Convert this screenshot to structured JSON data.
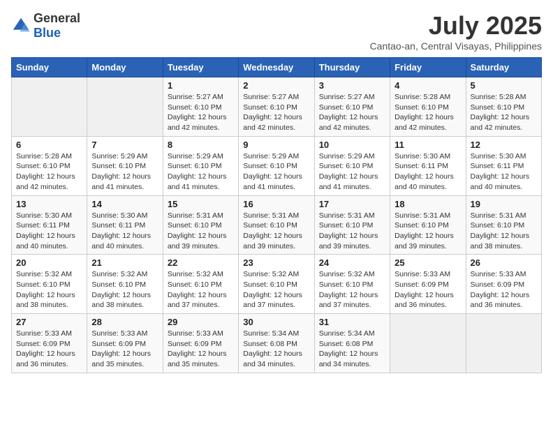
{
  "header": {
    "logo_general": "General",
    "logo_blue": "Blue",
    "title": "July 2025",
    "subtitle": "Cantao-an, Central Visayas, Philippines"
  },
  "weekdays": [
    "Sunday",
    "Monday",
    "Tuesday",
    "Wednesday",
    "Thursday",
    "Friday",
    "Saturday"
  ],
  "weeks": [
    [
      {
        "day": "",
        "info": ""
      },
      {
        "day": "",
        "info": ""
      },
      {
        "day": "1",
        "info": "Sunrise: 5:27 AM\nSunset: 6:10 PM\nDaylight: 12 hours and 42 minutes."
      },
      {
        "day": "2",
        "info": "Sunrise: 5:27 AM\nSunset: 6:10 PM\nDaylight: 12 hours and 42 minutes."
      },
      {
        "day": "3",
        "info": "Sunrise: 5:27 AM\nSunset: 6:10 PM\nDaylight: 12 hours and 42 minutes."
      },
      {
        "day": "4",
        "info": "Sunrise: 5:28 AM\nSunset: 6:10 PM\nDaylight: 12 hours and 42 minutes."
      },
      {
        "day": "5",
        "info": "Sunrise: 5:28 AM\nSunset: 6:10 PM\nDaylight: 12 hours and 42 minutes."
      }
    ],
    [
      {
        "day": "6",
        "info": "Sunrise: 5:28 AM\nSunset: 6:10 PM\nDaylight: 12 hours and 42 minutes."
      },
      {
        "day": "7",
        "info": "Sunrise: 5:29 AM\nSunset: 6:10 PM\nDaylight: 12 hours and 41 minutes."
      },
      {
        "day": "8",
        "info": "Sunrise: 5:29 AM\nSunset: 6:10 PM\nDaylight: 12 hours and 41 minutes."
      },
      {
        "day": "9",
        "info": "Sunrise: 5:29 AM\nSunset: 6:10 PM\nDaylight: 12 hours and 41 minutes."
      },
      {
        "day": "10",
        "info": "Sunrise: 5:29 AM\nSunset: 6:10 PM\nDaylight: 12 hours and 41 minutes."
      },
      {
        "day": "11",
        "info": "Sunrise: 5:30 AM\nSunset: 6:11 PM\nDaylight: 12 hours and 40 minutes."
      },
      {
        "day": "12",
        "info": "Sunrise: 5:30 AM\nSunset: 6:11 PM\nDaylight: 12 hours and 40 minutes."
      }
    ],
    [
      {
        "day": "13",
        "info": "Sunrise: 5:30 AM\nSunset: 6:11 PM\nDaylight: 12 hours and 40 minutes."
      },
      {
        "day": "14",
        "info": "Sunrise: 5:30 AM\nSunset: 6:11 PM\nDaylight: 12 hours and 40 minutes."
      },
      {
        "day": "15",
        "info": "Sunrise: 5:31 AM\nSunset: 6:10 PM\nDaylight: 12 hours and 39 minutes."
      },
      {
        "day": "16",
        "info": "Sunrise: 5:31 AM\nSunset: 6:10 PM\nDaylight: 12 hours and 39 minutes."
      },
      {
        "day": "17",
        "info": "Sunrise: 5:31 AM\nSunset: 6:10 PM\nDaylight: 12 hours and 39 minutes."
      },
      {
        "day": "18",
        "info": "Sunrise: 5:31 AM\nSunset: 6:10 PM\nDaylight: 12 hours and 39 minutes."
      },
      {
        "day": "19",
        "info": "Sunrise: 5:31 AM\nSunset: 6:10 PM\nDaylight: 12 hours and 38 minutes."
      }
    ],
    [
      {
        "day": "20",
        "info": "Sunrise: 5:32 AM\nSunset: 6:10 PM\nDaylight: 12 hours and 38 minutes."
      },
      {
        "day": "21",
        "info": "Sunrise: 5:32 AM\nSunset: 6:10 PM\nDaylight: 12 hours and 38 minutes."
      },
      {
        "day": "22",
        "info": "Sunrise: 5:32 AM\nSunset: 6:10 PM\nDaylight: 12 hours and 37 minutes."
      },
      {
        "day": "23",
        "info": "Sunrise: 5:32 AM\nSunset: 6:10 PM\nDaylight: 12 hours and 37 minutes."
      },
      {
        "day": "24",
        "info": "Sunrise: 5:32 AM\nSunset: 6:10 PM\nDaylight: 12 hours and 37 minutes."
      },
      {
        "day": "25",
        "info": "Sunrise: 5:33 AM\nSunset: 6:09 PM\nDaylight: 12 hours and 36 minutes."
      },
      {
        "day": "26",
        "info": "Sunrise: 5:33 AM\nSunset: 6:09 PM\nDaylight: 12 hours and 36 minutes."
      }
    ],
    [
      {
        "day": "27",
        "info": "Sunrise: 5:33 AM\nSunset: 6:09 PM\nDaylight: 12 hours and 36 minutes."
      },
      {
        "day": "28",
        "info": "Sunrise: 5:33 AM\nSunset: 6:09 PM\nDaylight: 12 hours and 35 minutes."
      },
      {
        "day": "29",
        "info": "Sunrise: 5:33 AM\nSunset: 6:09 PM\nDaylight: 12 hours and 35 minutes."
      },
      {
        "day": "30",
        "info": "Sunrise: 5:34 AM\nSunset: 6:08 PM\nDaylight: 12 hours and 34 minutes."
      },
      {
        "day": "31",
        "info": "Sunrise: 5:34 AM\nSunset: 6:08 PM\nDaylight: 12 hours and 34 minutes."
      },
      {
        "day": "",
        "info": ""
      },
      {
        "day": "",
        "info": ""
      }
    ]
  ]
}
